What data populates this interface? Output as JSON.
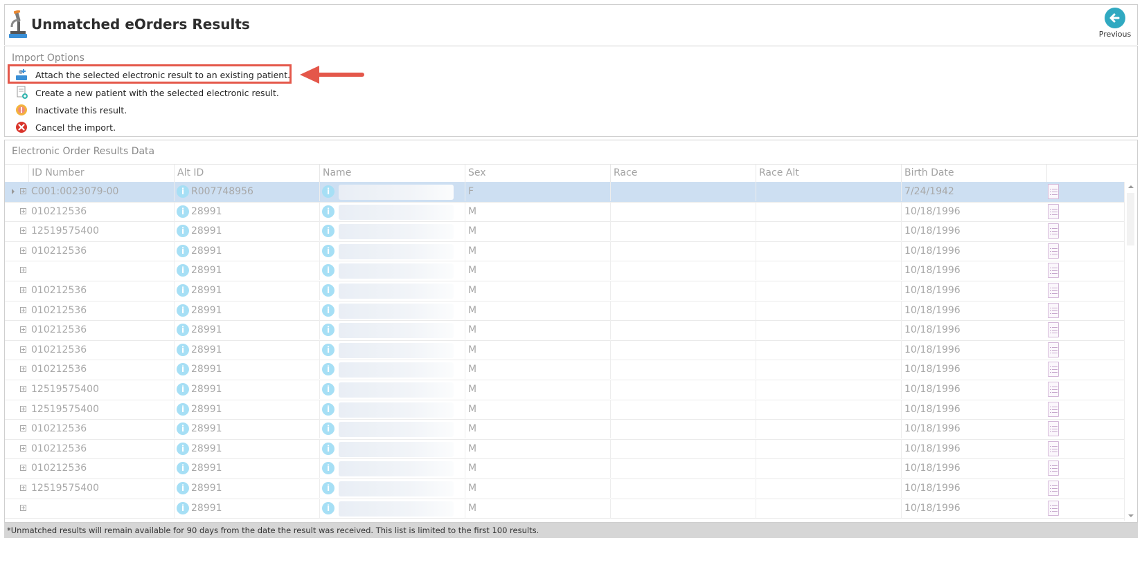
{
  "header": {
    "title": "Unmatched eOrders Results",
    "previous_label": "Previous"
  },
  "import_options": {
    "title": "Import Options",
    "options": [
      {
        "label": "Attach the selected electronic result to an existing patient.",
        "icon": "attach-patient-icon"
      },
      {
        "label": "Create a new patient with the selected electronic result.",
        "icon": "new-patient-icon"
      },
      {
        "label": "Inactivate this result.",
        "icon": "warning-icon"
      },
      {
        "label": "Cancel the import.",
        "icon": "cancel-icon"
      }
    ]
  },
  "grid": {
    "title": "Electronic Order Results Data",
    "columns": [
      "ID Number",
      "Alt ID",
      "Name",
      "Sex",
      "Race",
      "Race Alt",
      "Birth Date"
    ],
    "rows": [
      {
        "id": "C001:0023079-00",
        "alt_id": "R007748956",
        "sex": "F",
        "race": "",
        "race_alt": "",
        "birth": "7/24/1942",
        "selected": true
      },
      {
        "id": "010212536",
        "alt_id": "28991",
        "sex": "M",
        "race": "",
        "race_alt": "",
        "birth": "10/18/1996"
      },
      {
        "id": "12519575400",
        "alt_id": "28991",
        "sex": "M",
        "race": "",
        "race_alt": "",
        "birth": "10/18/1996"
      },
      {
        "id": "010212536",
        "alt_id": "28991",
        "sex": "M",
        "race": "",
        "race_alt": "",
        "birth": "10/18/1996"
      },
      {
        "id": "",
        "alt_id": "28991",
        "sex": "M",
        "race": "",
        "race_alt": "",
        "birth": "10/18/1996"
      },
      {
        "id": "010212536",
        "alt_id": "28991",
        "sex": "M",
        "race": "",
        "race_alt": "",
        "birth": "10/18/1996"
      },
      {
        "id": "010212536",
        "alt_id": "28991",
        "sex": "M",
        "race": "",
        "race_alt": "",
        "birth": "10/18/1996"
      },
      {
        "id": "010212536",
        "alt_id": "28991",
        "sex": "M",
        "race": "",
        "race_alt": "",
        "birth": "10/18/1996"
      },
      {
        "id": "010212536",
        "alt_id": "28991",
        "sex": "M",
        "race": "",
        "race_alt": "",
        "birth": "10/18/1996"
      },
      {
        "id": "010212536",
        "alt_id": "28991",
        "sex": "M",
        "race": "",
        "race_alt": "",
        "birth": "10/18/1996"
      },
      {
        "id": "12519575400",
        "alt_id": "28991",
        "sex": "M",
        "race": "",
        "race_alt": "",
        "birth": "10/18/1996"
      },
      {
        "id": "12519575400",
        "alt_id": "28991",
        "sex": "M",
        "race": "",
        "race_alt": "",
        "birth": "10/18/1996"
      },
      {
        "id": "010212536",
        "alt_id": "28991",
        "sex": "M",
        "race": "",
        "race_alt": "",
        "birth": "10/18/1996"
      },
      {
        "id": "010212536",
        "alt_id": "28991",
        "sex": "M",
        "race": "",
        "race_alt": "",
        "birth": "10/18/1996"
      },
      {
        "id": "010212536",
        "alt_id": "28991",
        "sex": "M",
        "race": "",
        "race_alt": "",
        "birth": "10/18/1996"
      },
      {
        "id": "12519575400",
        "alt_id": "28991",
        "sex": "M",
        "race": "",
        "race_alt": "",
        "birth": "10/18/1996"
      },
      {
        "id": "",
        "alt_id": "28991",
        "sex": "M",
        "race": "",
        "race_alt": "",
        "birth": "10/18/1996"
      }
    ]
  },
  "footer": {
    "note": "*Unmatched results will remain available for 90 days from the date the result was received. This list is limited to the first 100 results."
  },
  "colors": {
    "accent": "#30a9c1",
    "highlight": "#e4574a",
    "selected_row": "#cddff2",
    "info_icon": "#a6dff5"
  }
}
